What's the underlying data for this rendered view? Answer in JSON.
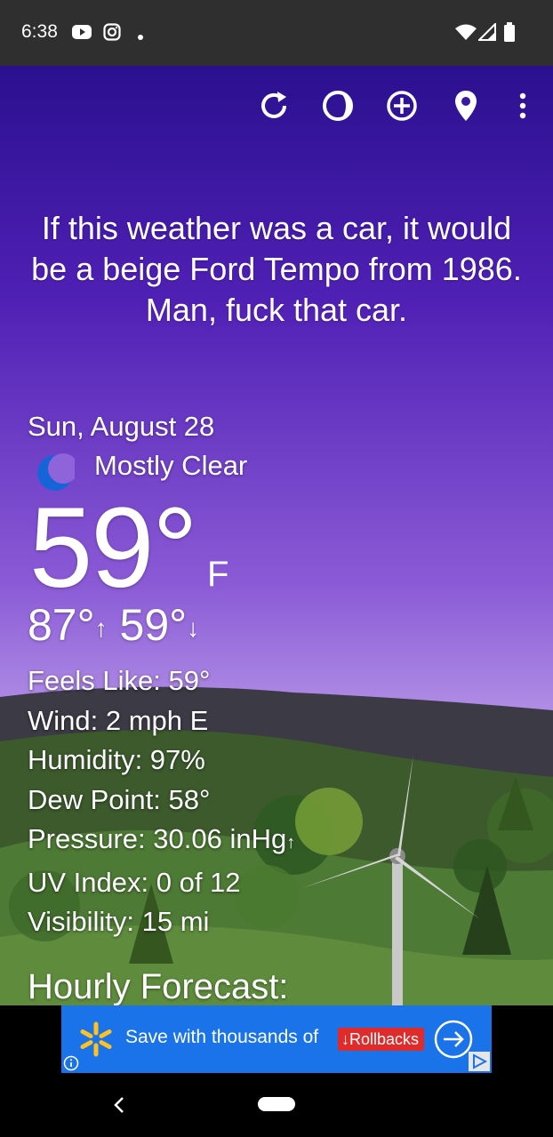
{
  "status_bar": {
    "time": "6:38",
    "left_icons": [
      "youtube-icon",
      "instagram-icon",
      "dot-icon"
    ],
    "right_icons": [
      "wifi-icon",
      "cell-signal-icon",
      "battery-icon"
    ]
  },
  "toolbar": {
    "icons": [
      "refresh-icon",
      "theme-icon",
      "add-location-icon",
      "location-pin-icon",
      "more-options-icon"
    ]
  },
  "quote": "If this weather was a car, it would be a beige Ford Tempo from 1986. Man, fuck that car.",
  "current": {
    "date": "Sun, August 28",
    "condition": "Mostly Clear",
    "condition_icon": "crescent-moon-icon",
    "temperature": "59°",
    "unit": "F",
    "high": "87°",
    "high_arrow": "↑",
    "low": "59°",
    "low_arrow": "↓"
  },
  "details": {
    "feels_like": "Feels Like:  59°",
    "wind": "Wind:  2 mph E",
    "humidity": "Humidity:  97%",
    "dew_point": "Dew Point:  58°",
    "pressure": "Pressure:  30.06 inHg",
    "pressure_trend": "↑",
    "uv_index": "UV Index:  0 of 12",
    "visibility": "Visibility:  15 mi"
  },
  "hourly_title": "Hourly Forecast:",
  "ad": {
    "text": "Save with thousands of",
    "badge": "Rollbacks",
    "badge_arrow": "↓"
  },
  "colors": {
    "sky_top": "#2a108f",
    "sky_bottom": "#c5b0ee",
    "ad_blue": "#1a73e8",
    "ad_red": "#e02b2b"
  }
}
